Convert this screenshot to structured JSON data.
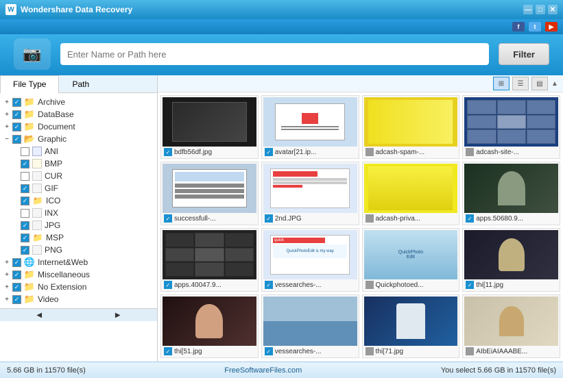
{
  "app": {
    "title": "Wondershare Data Recovery",
    "icon": "📷"
  },
  "titlebar": {
    "minimize": "—",
    "maximize": "□",
    "close": "✕"
  },
  "social": {
    "fb": "f",
    "tw": "t",
    "yt": "▶"
  },
  "search": {
    "placeholder": "Enter Name or Path here",
    "filter_label": "Filter"
  },
  "tabs": {
    "file_type": "File Type",
    "path": "Path"
  },
  "tree": {
    "items": [
      {
        "id": "archive",
        "label": "Archive",
        "level": 1,
        "expandable": true,
        "checked": true,
        "type": "folder"
      },
      {
        "id": "database",
        "label": "DataBase",
        "level": 1,
        "expandable": true,
        "checked": true,
        "type": "folder"
      },
      {
        "id": "document",
        "label": "Document",
        "level": 1,
        "expandable": true,
        "checked": true,
        "type": "folder"
      },
      {
        "id": "graphic",
        "label": "Graphic",
        "level": 1,
        "expandable": true,
        "checked": true,
        "type": "folder",
        "expanded": true
      },
      {
        "id": "ani",
        "label": "ANI",
        "level": 2,
        "expandable": false,
        "checked": false,
        "type": "file"
      },
      {
        "id": "bmp",
        "label": "BMP",
        "level": 2,
        "expandable": false,
        "checked": true,
        "type": "file"
      },
      {
        "id": "cur",
        "label": "CUR",
        "level": 2,
        "expandable": false,
        "checked": false,
        "type": "file"
      },
      {
        "id": "gif",
        "label": "GIF",
        "level": 2,
        "expandable": false,
        "checked": true,
        "type": "file"
      },
      {
        "id": "ico",
        "label": "ICO",
        "level": 2,
        "expandable": false,
        "checked": true,
        "type": "folder2"
      },
      {
        "id": "inx",
        "label": "INX",
        "level": 2,
        "expandable": false,
        "checked": false,
        "type": "file"
      },
      {
        "id": "jpg",
        "label": "JPG",
        "level": 2,
        "expandable": false,
        "checked": true,
        "type": "file"
      },
      {
        "id": "msp",
        "label": "MSP",
        "level": 2,
        "expandable": false,
        "checked": true,
        "type": "folder2"
      },
      {
        "id": "png",
        "label": "PNG",
        "level": 2,
        "expandable": false,
        "checked": true,
        "type": "file"
      },
      {
        "id": "internet",
        "label": "Internet&Web",
        "level": 1,
        "expandable": true,
        "checked": true,
        "type": "folder"
      },
      {
        "id": "misc",
        "label": "Miscellaneous",
        "level": 1,
        "expandable": true,
        "checked": true,
        "type": "folder"
      },
      {
        "id": "noext",
        "label": "No Extension",
        "level": 1,
        "expandable": true,
        "checked": true,
        "type": "folder"
      },
      {
        "id": "video",
        "label": "Video",
        "level": 1,
        "expandable": true,
        "checked": true,
        "type": "folder"
      }
    ]
  },
  "toolbar": {
    "views": [
      "⊞",
      "☰",
      "▦"
    ]
  },
  "grid": {
    "items": [
      {
        "label": "bdfb56df.jpg",
        "thumb": "dark",
        "checked": true
      },
      {
        "label": "avatar[21.jp...",
        "thumb": "dialog",
        "checked": true
      },
      {
        "label": "adcash-spam-...",
        "thumb": "yellow",
        "checked": false
      },
      {
        "label": "adcash-site-...",
        "thumb": "blue_grid",
        "checked": false
      },
      {
        "label": "successfull-...",
        "thumb": "dialog2",
        "checked": true
      },
      {
        "label": "2nd.JPG",
        "thumb": "dialog3",
        "checked": true
      },
      {
        "label": "adcash-priva...",
        "thumb": "yellow2",
        "checked": false
      },
      {
        "label": "apps.50680.9...",
        "thumb": "person",
        "checked": true
      },
      {
        "label": "apps.40047.9...",
        "thumb": "grid_dark",
        "checked": true
      },
      {
        "label": "vessearches-...",
        "thumb": "red_dialog",
        "checked": true
      },
      {
        "label": "Quickphotoed...",
        "thumb": "photo_site",
        "checked": false
      },
      {
        "label": "thi[11.jpg",
        "thumb": "person2",
        "checked": true
      },
      {
        "label": "thi[51.jpg",
        "thumb": "person3",
        "checked": true
      },
      {
        "label": "vessearches-...",
        "thumb": "ocean",
        "checked": true
      },
      {
        "label": "thi[71.jpg",
        "thumb": "baseball",
        "checked": false
      },
      {
        "label": "AIbEiAIAAABE...",
        "thumb": "face",
        "checked": false
      }
    ]
  },
  "status": {
    "left": "5.66 GB in 11570 file(s)",
    "center": "FreeSoftwareFiles.com",
    "right": "You select 5.66 GB in 11570 file(s)"
  }
}
